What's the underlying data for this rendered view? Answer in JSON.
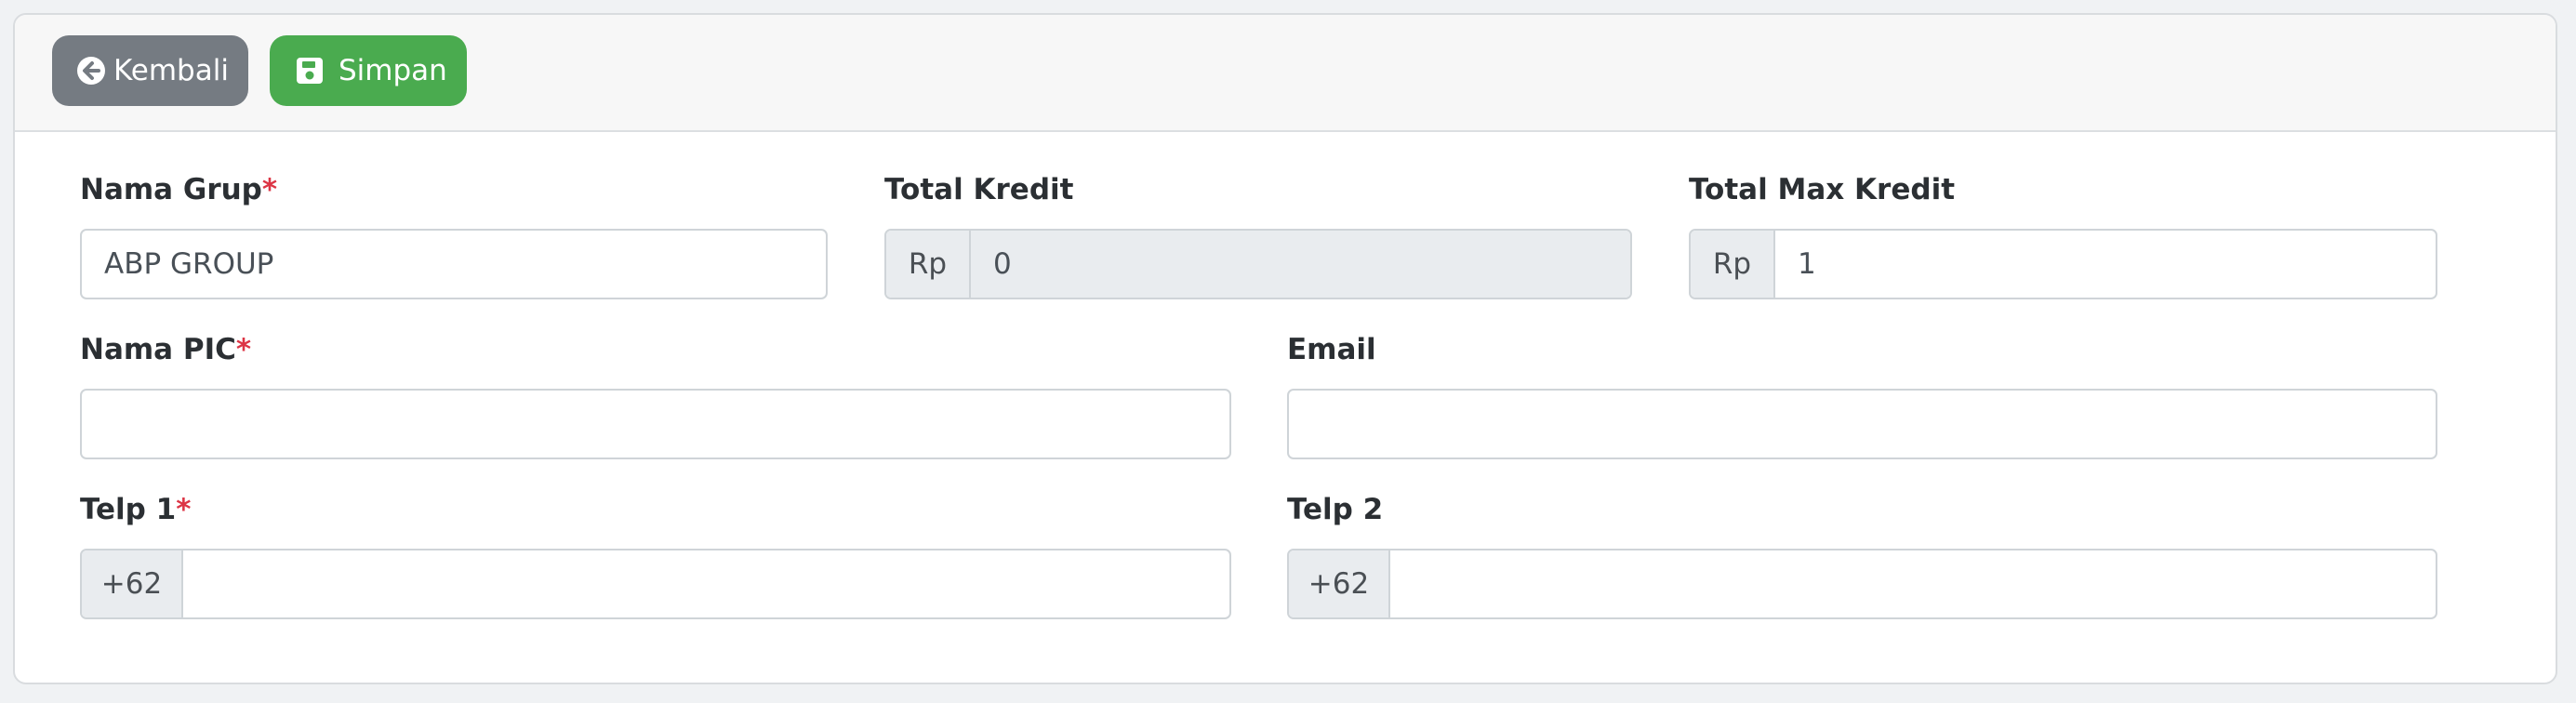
{
  "toolbar": {
    "back_label": "Kembali",
    "save_label": "Simpan"
  },
  "form": {
    "nama_grup": {
      "label": "Nama Grup",
      "required_mark": "*",
      "value": "ABP GROUP"
    },
    "total_kredit": {
      "label": "Total Kredit",
      "prefix": "Rp",
      "value": "0"
    },
    "total_max_kredit": {
      "label": "Total Max Kredit",
      "prefix": "Rp",
      "value": "1"
    },
    "nama_pic": {
      "label": "Nama PIC",
      "required_mark": "*",
      "value": ""
    },
    "email": {
      "label": "Email",
      "value": ""
    },
    "telp1": {
      "label": "Telp 1",
      "required_mark": "*",
      "prefix": "+62",
      "value": ""
    },
    "telp2": {
      "label": "Telp 2",
      "prefix": "+62",
      "value": ""
    }
  },
  "colors": {
    "back_button": "#757b82",
    "save_button": "#4aab4f",
    "required": "#dc3545",
    "readonly_bg": "#e9ecef"
  },
  "icons": {
    "back": "arrow-circle-left-icon",
    "save": "floppy-disk-icon"
  }
}
